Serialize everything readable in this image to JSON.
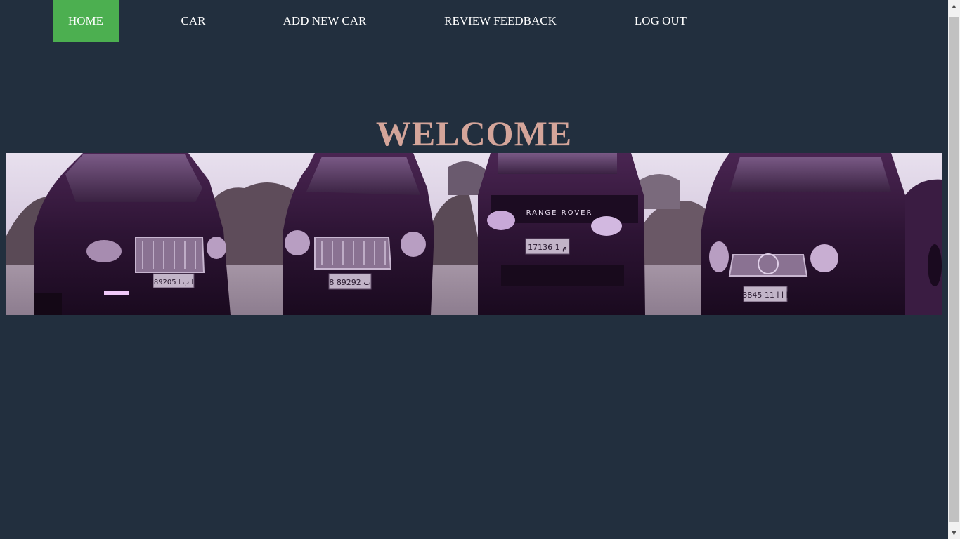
{
  "nav": {
    "items": [
      {
        "label": "HOME",
        "active": true
      },
      {
        "label": "CAR"
      },
      {
        "label": "ADD NEW CAR"
      },
      {
        "label": "REVIEW FEEDBACK"
      },
      {
        "label": "LOG OUT"
      }
    ],
    "active_color": "#4caf50"
  },
  "main": {
    "title": "WELCOME",
    "title_color": "#d4a59a"
  },
  "banner": {
    "subject": "four dark purple-tinted luxury vehicles parked in a row",
    "plates": [
      "89205 ا ب ا",
      "8 ب 89292",
      "17136 م 1",
      "3845 ا ا ا 11"
    ],
    "grille_text": "RANGE ROVER"
  },
  "colors": {
    "background": "#222f3e",
    "nav_text": "#ffffff"
  },
  "scrollbar": {
    "up_icon": "▲",
    "down_icon": "▼"
  }
}
